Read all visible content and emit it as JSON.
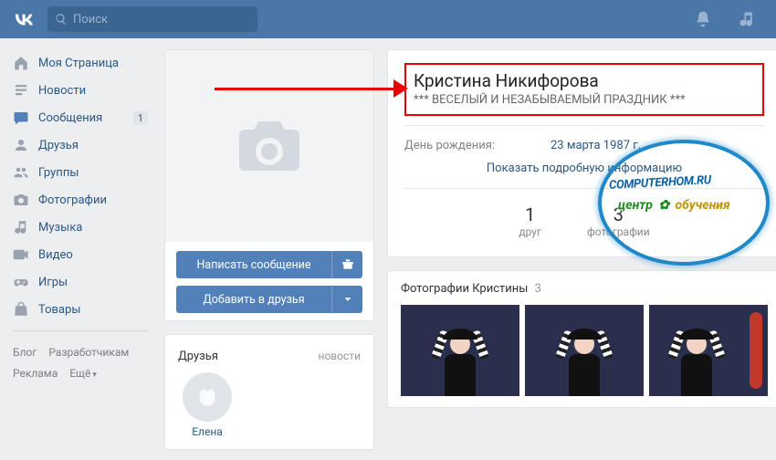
{
  "header": {
    "search_placeholder": "Поиск"
  },
  "sidebar": {
    "items": [
      {
        "label": "Моя Страница"
      },
      {
        "label": "Новости"
      },
      {
        "label": "Сообщения",
        "badge": "1"
      },
      {
        "label": "Друзья"
      },
      {
        "label": "Группы"
      },
      {
        "label": "Фотографии"
      },
      {
        "label": "Музыка"
      },
      {
        "label": "Видео"
      },
      {
        "label": "Игры"
      },
      {
        "label": "Товары"
      }
    ],
    "footer": {
      "blog": "Блог",
      "developers": "Разработчикам",
      "ads": "Реклама",
      "more": "Ещё"
    }
  },
  "actions": {
    "write_message": "Написать сообщение",
    "add_friend": "Добавить в друзья"
  },
  "friends_block": {
    "title": "Друзья",
    "count": "",
    "tab_news": "новости",
    "items": [
      {
        "name": "Елена"
      }
    ]
  },
  "profile": {
    "name": "Кристина Никифорова",
    "status": "*** ВЕСЕЛЫЙ И НЕЗАБЫВАЕМЫЙ ПРАЗДНИК ***",
    "birthday_label": "День рождения:",
    "birthday_value": "23 марта 1987 г.",
    "show_more": "Показать подробную информацию",
    "counters": [
      {
        "num": "1",
        "lbl": "друг"
      },
      {
        "num": "3",
        "lbl": "фотографии"
      }
    ]
  },
  "photos_block": {
    "title": "Фотографии Кристины",
    "count": "3"
  },
  "watermark": {
    "line1": "COMPUTERHOM.RU",
    "line2_a": "центр",
    "line2_star": "✿",
    "line2_b": "обучения"
  }
}
